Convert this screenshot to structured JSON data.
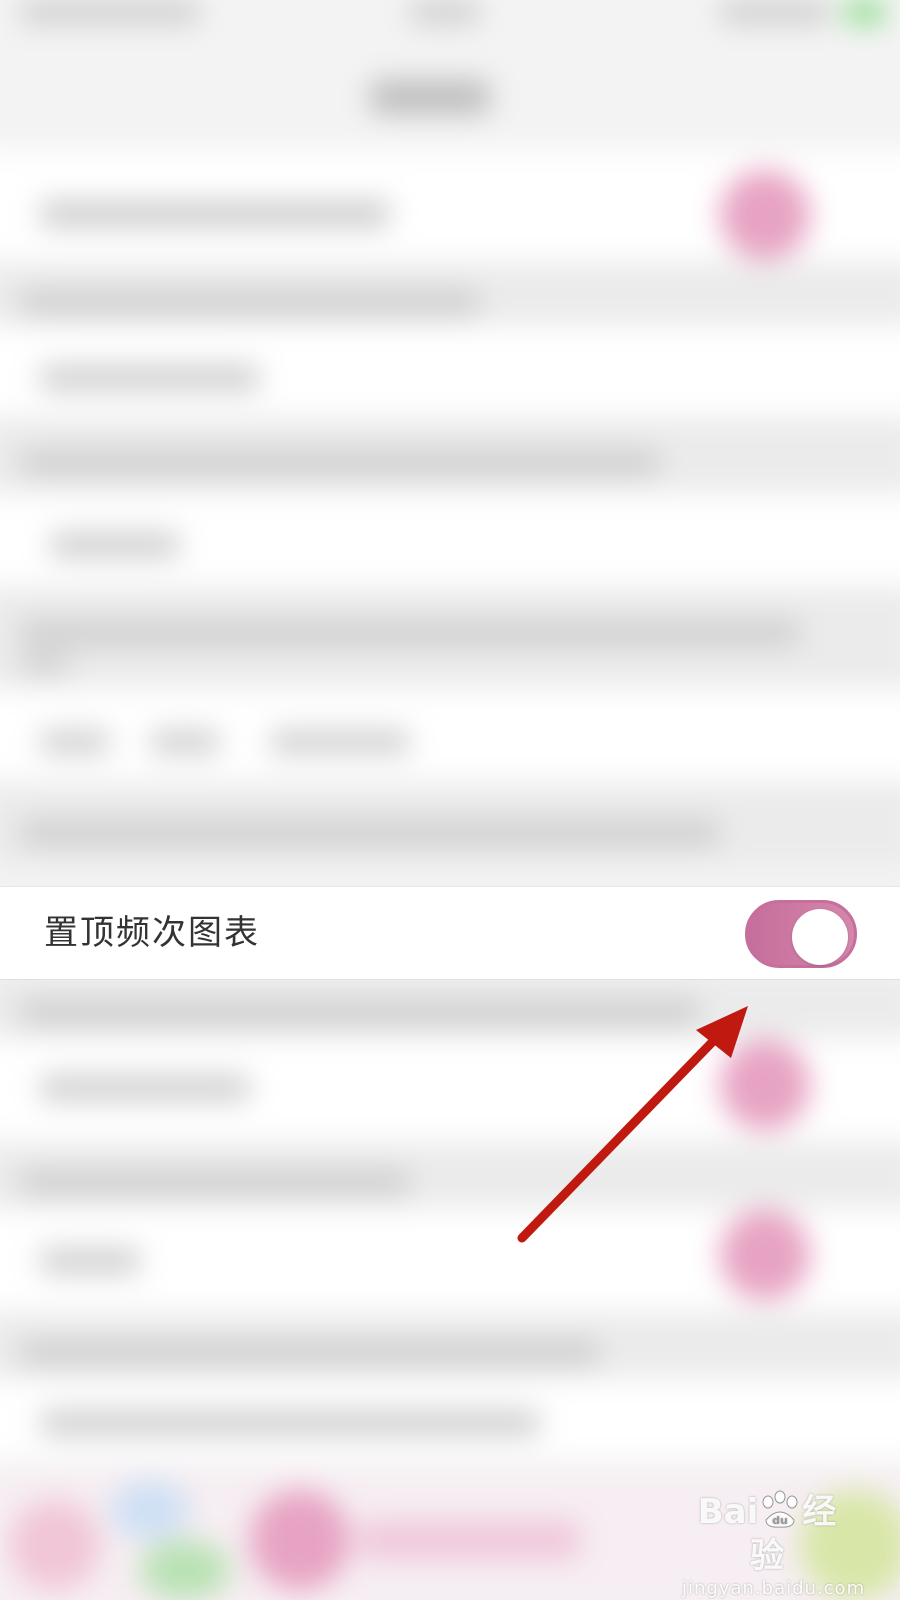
{
  "colors": {
    "accent": "#c66e9c",
    "arrow": "#c0190f",
    "row_bg": "#ffffff",
    "label": "#333333"
  },
  "setting_row": {
    "label": "置顶频次图表",
    "toggle_state": "on"
  },
  "watermark": {
    "brand": "Bai",
    "brand_suffix": "经验",
    "url": "jingyan.baidu.com",
    "logo_icon": "baidu-paw-icon"
  }
}
